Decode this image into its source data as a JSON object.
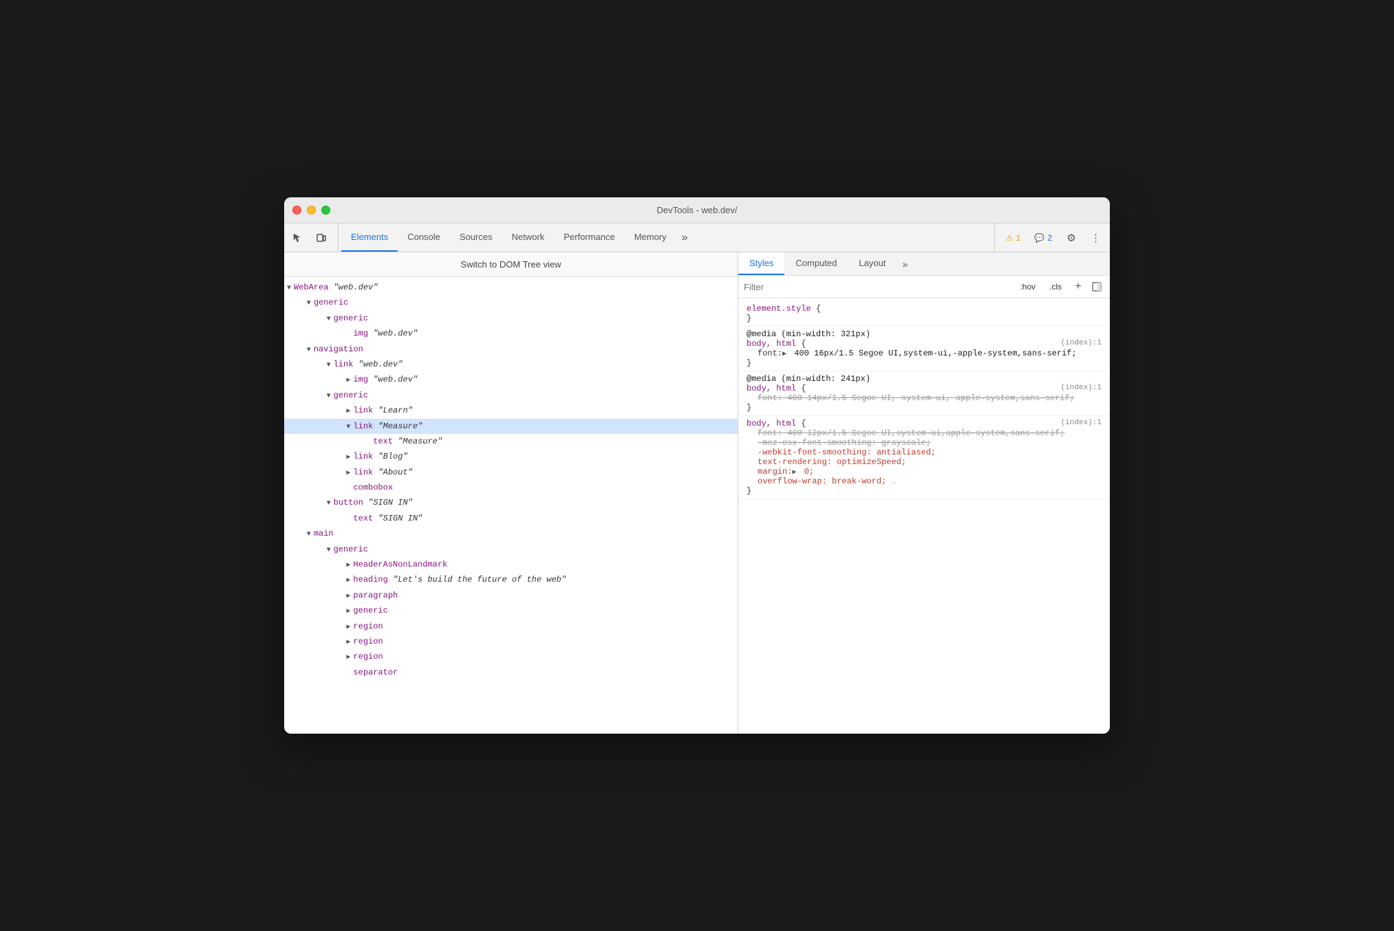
{
  "window": {
    "title": "DevTools - web.dev/"
  },
  "toolbar": {
    "tabs": [
      {
        "id": "elements",
        "label": "Elements",
        "active": true
      },
      {
        "id": "console",
        "label": "Console",
        "active": false
      },
      {
        "id": "sources",
        "label": "Sources",
        "active": false
      },
      {
        "id": "network",
        "label": "Network",
        "active": false
      },
      {
        "id": "performance",
        "label": "Performance",
        "active": false
      },
      {
        "id": "memory",
        "label": "Memory",
        "active": false
      }
    ],
    "more_label": "»",
    "warn_count": "1",
    "info_count": "2"
  },
  "dom_panel": {
    "switch_button": "Switch to DOM Tree view",
    "tree": [
      {
        "indent": 0,
        "toggle": "▼",
        "content": "WebArea ",
        "italic": "\"web.dev\""
      },
      {
        "indent": 1,
        "toggle": "▼",
        "content": "generic"
      },
      {
        "indent": 2,
        "toggle": "▼",
        "content": "generic"
      },
      {
        "indent": 3,
        "toggle": " ",
        "content": "img ",
        "italic": "\"web.dev\""
      },
      {
        "indent": 1,
        "toggle": "▼",
        "content": "navigation"
      },
      {
        "indent": 2,
        "toggle": "▼",
        "content": "link ",
        "italic": "\"web.dev\""
      },
      {
        "indent": 3,
        "toggle": "▶",
        "content": "img ",
        "italic": "\"web.dev\""
      },
      {
        "indent": 2,
        "toggle": "▼",
        "content": "generic"
      },
      {
        "indent": 3,
        "toggle": "▶",
        "content": "link ",
        "italic": "\"Learn\""
      },
      {
        "indent": 3,
        "toggle": "▼",
        "content": "link ",
        "italic": "\"Measure\"",
        "selected": true
      },
      {
        "indent": 4,
        "toggle": " ",
        "content": "text ",
        "italic": "\"Measure\""
      },
      {
        "indent": 3,
        "toggle": "▶",
        "content": "link ",
        "italic": "\"Blog\""
      },
      {
        "indent": 3,
        "toggle": "▶",
        "content": "link ",
        "italic": "\"About\""
      },
      {
        "indent": 3,
        "toggle": " ",
        "content": "combobox"
      },
      {
        "indent": 2,
        "toggle": "▼",
        "content": "button ",
        "italic": "\"SIGN IN\""
      },
      {
        "indent": 3,
        "toggle": " ",
        "content": "text ",
        "italic": "\"SIGN IN\""
      },
      {
        "indent": 1,
        "toggle": "▼",
        "content": "main"
      },
      {
        "indent": 2,
        "toggle": "▼",
        "content": "generic"
      },
      {
        "indent": 3,
        "toggle": "▶",
        "content": "HeaderAsNonLandmark"
      },
      {
        "indent": 3,
        "toggle": "▶",
        "content": "heading ",
        "italic": "\"Let's build the future of the web\""
      },
      {
        "indent": 3,
        "toggle": "▶",
        "content": "paragraph"
      },
      {
        "indent": 3,
        "toggle": "▶",
        "content": "generic"
      },
      {
        "indent": 3,
        "toggle": "▶",
        "content": "region"
      },
      {
        "indent": 3,
        "toggle": "▶",
        "content": "region"
      },
      {
        "indent": 3,
        "toggle": "▶",
        "content": "region"
      },
      {
        "indent": 3,
        "toggle": " ",
        "content": "separator"
      }
    ]
  },
  "styles_panel": {
    "tabs": [
      {
        "label": "Styles",
        "active": true
      },
      {
        "label": "Computed",
        "active": false
      },
      {
        "label": "Layout",
        "active": false
      }
    ],
    "more_label": "»",
    "filter_placeholder": "Filter",
    "filter_hov": ":hov",
    "filter_cls": ".cls",
    "rules": [
      {
        "type": "element_style",
        "selector": "element.style {",
        "close": "}",
        "properties": []
      },
      {
        "type": "media_rule",
        "media": "@media (min-width: 321px)",
        "selector": "body, html {",
        "source": "(index):1",
        "close": "}",
        "properties": [
          {
            "name": "font:",
            "triangle": true,
            "value": " 400 16px/1.5 Segoe UI,system-ui,-apple-system,sans-serif;",
            "strikethrough": false,
            "red": false
          }
        ]
      },
      {
        "type": "media_rule",
        "media": "@media (min-width: 241px)",
        "selector": "body, html {",
        "source": "(index):1",
        "close": "}",
        "properties": [
          {
            "name": "font:",
            "triangle": true,
            "value": " 400 14px/1.5 Segoe UI, system-ui, apple-system,sans-serif;",
            "strikethrough": true,
            "red": false
          }
        ]
      },
      {
        "type": "plain_rule",
        "selector": "body, html {",
        "source": "(index):1",
        "close": "}",
        "properties": [
          {
            "name": "font:",
            "triangle": true,
            "value": " 400 12px/1.5 Segoe UI,system-ui,apple-system,sans-serif;",
            "strikethrough": true,
            "red": false
          },
          {
            "name": "-moz-osx-font-smoothing:",
            "value": " grayscale;",
            "strikethrough": true,
            "red": false
          },
          {
            "name": "-webkit-font-smoothing:",
            "value": " antialiased;",
            "strikethrough": false,
            "red": true
          },
          {
            "name": "text-rendering:",
            "value": " optimizeSpeed;",
            "strikethrough": false,
            "red": true
          },
          {
            "name": "margin:",
            "triangle": true,
            "value": " 0;",
            "strikethrough": false,
            "red": true
          },
          {
            "name": "overflow-wrap:",
            "value": " break-word;",
            "strikethrough": false,
            "red": true,
            "partial": true
          }
        ]
      }
    ]
  }
}
